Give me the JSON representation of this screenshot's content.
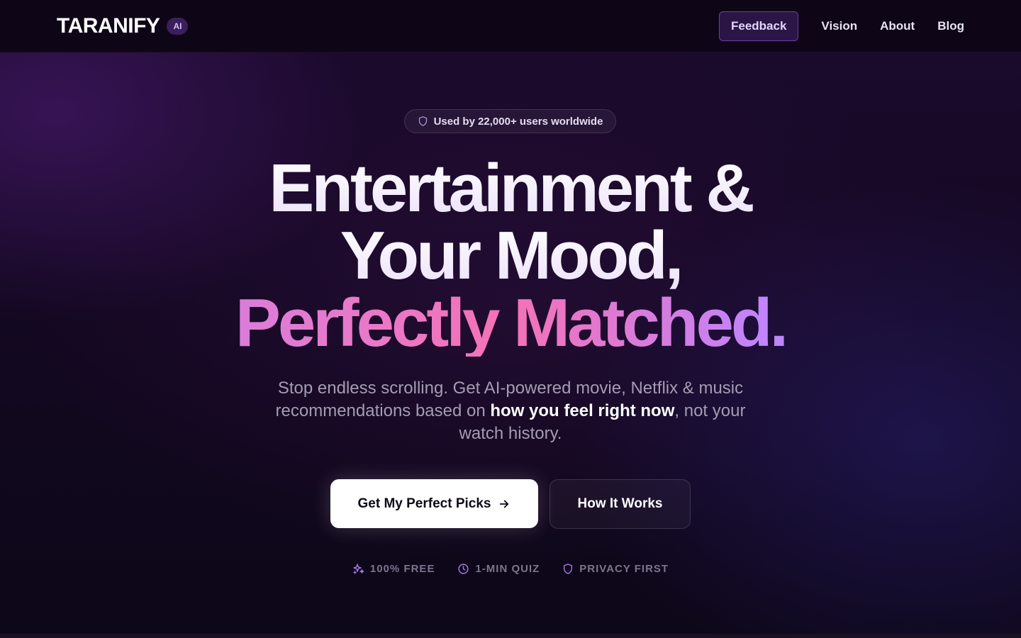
{
  "header": {
    "logo_text": "TARANIFY",
    "logo_badge": "AI",
    "nav": {
      "feedback": "Feedback",
      "vision": "Vision",
      "about": "About",
      "blog": "Blog"
    }
  },
  "hero": {
    "pill": {
      "icon": "shield-icon",
      "text": "Used by 22,000+ users worldwide"
    },
    "headline": {
      "line1": "Entertainment &",
      "line2": "Your Mood,",
      "line3": "Perfectly Matched."
    },
    "subtitle": {
      "before": "Stop endless scrolling. Get AI-powered movie, Netflix & music recommendations based on ",
      "emphasis": "how you feel right now",
      "after": ", not your watch history."
    },
    "cta_primary": {
      "label": "Get My Perfect Picks",
      "icon": "arrow-right-icon"
    },
    "cta_secondary": {
      "label": "How It Works"
    },
    "features": [
      {
        "icon": "sparkles-icon",
        "label": "100% FREE"
      },
      {
        "icon": "clock-icon",
        "label": "1-MIN QUIZ"
      },
      {
        "icon": "shield-icon",
        "label": "PRIVACY FIRST"
      }
    ]
  },
  "colors": {
    "background": "#140822",
    "header_background": "#0e0617",
    "accent_purple": "#c084fc",
    "accent_pink": "#f472b6",
    "accent_indigo": "#818cf8",
    "feedback_border": "#6b3fa8",
    "muted_text": "#a49cb3"
  }
}
